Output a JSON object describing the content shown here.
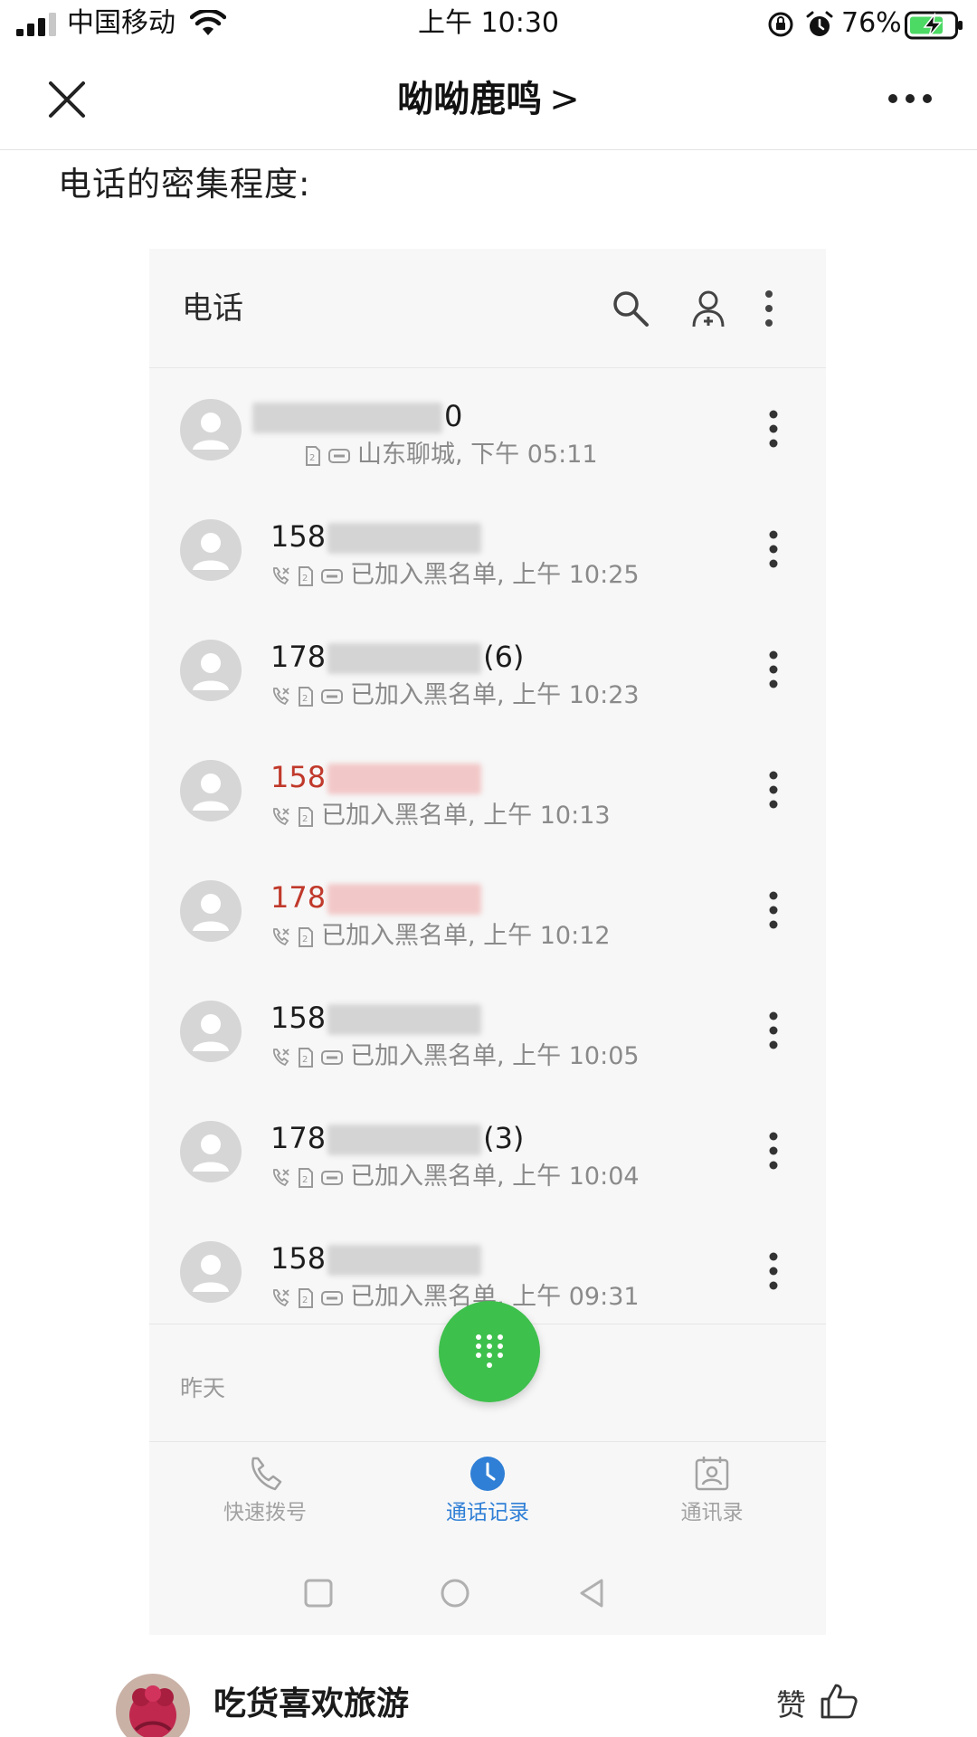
{
  "status_bar": {
    "carrier": "中国移动",
    "time": "上午 10:30",
    "battery": "76%"
  },
  "nav": {
    "title": "呦呦鹿鸣",
    "chevron": ">"
  },
  "article": {
    "intro": "电话的密集程度:"
  },
  "phone": {
    "title": "电话",
    "calls": [
      {
        "number_prefix": "",
        "number_suffix": "0",
        "meta": "山东聊城, 下午 05:11",
        "missed": false
      },
      {
        "number_prefix": "158",
        "number_suffix": "",
        "meta": "已加入黑名单, 上午 10:25",
        "missed": false
      },
      {
        "number_prefix": "178",
        "number_suffix": "(6)",
        "meta": "已加入黑名单, 上午 10:23",
        "missed": false
      },
      {
        "number_prefix": "158",
        "number_suffix": "",
        "meta": "已加入黑名单, 上午 10:13",
        "missed": true
      },
      {
        "number_prefix": "178",
        "number_suffix": "",
        "meta": "已加入黑名单, 上午 10:12",
        "missed": true
      },
      {
        "number_prefix": "158",
        "number_suffix": "",
        "meta": "已加入黑名单, 上午 10:05",
        "missed": false
      },
      {
        "number_prefix": "178",
        "number_suffix": "(3)",
        "meta": "已加入黑名单, 上午 10:04",
        "missed": false
      },
      {
        "number_prefix": "158",
        "number_suffix": "",
        "meta": "已加入黑名单, 上午 09:31",
        "missed": false
      }
    ],
    "section_label": "昨天",
    "tabs": [
      {
        "label": "快速拨号",
        "icon": "phone-icon",
        "active": false
      },
      {
        "label": "通话记录",
        "icon": "clock-icon",
        "active": true
      },
      {
        "label": "通讯录",
        "icon": "contact-card-icon",
        "active": false
      }
    ]
  },
  "author": {
    "name": "吃货喜欢旅游",
    "like_label": "赞"
  },
  "colors": {
    "accent": "#2f7fd6",
    "fab": "#3ec04c",
    "missed": "#c0392b"
  }
}
